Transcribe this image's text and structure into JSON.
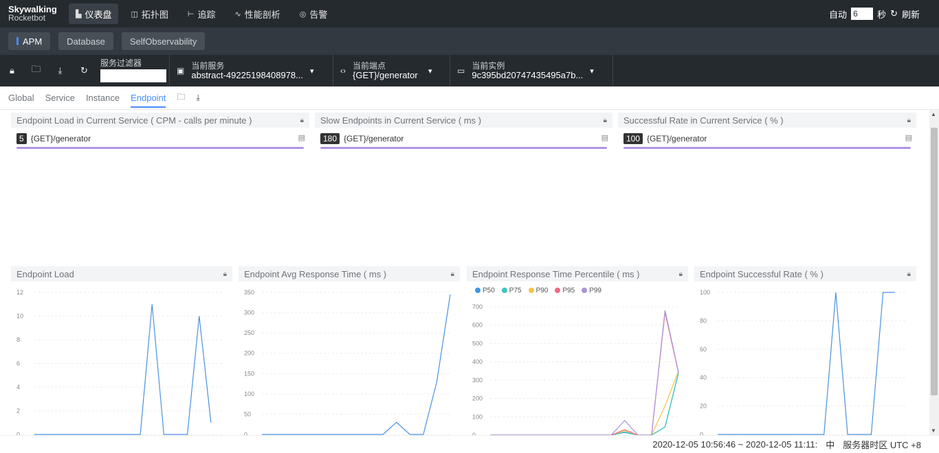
{
  "logo": {
    "line1": "Skywalking",
    "line2": "Rocketbot"
  },
  "nav": {
    "items": [
      {
        "label": "仪表盘",
        "icon": "dashboard-icon",
        "glyph": "▙",
        "active": true
      },
      {
        "label": "拓扑图",
        "icon": "topology-icon",
        "glyph": "◫",
        "active": false
      },
      {
        "label": "追踪",
        "icon": "trace-icon",
        "glyph": "⊢",
        "active": false
      },
      {
        "label": "性能剖析",
        "icon": "profile-icon",
        "glyph": "∿",
        "active": false
      },
      {
        "label": "告警",
        "icon": "alarm-icon",
        "glyph": "◎",
        "active": false
      }
    ],
    "auto_label": "自动",
    "auto_seconds": "6",
    "seconds_unit": "秒",
    "refresh_label": "刷新"
  },
  "groups": [
    "APM",
    "Database",
    "SelfObservability"
  ],
  "toolbar": {
    "filter_label": "服务过滤器",
    "filter_value": "",
    "service_label": "当前服务",
    "service_value": "abstract-49225198408978...",
    "endpoint_label": "当前端点",
    "endpoint_value": "{GET}/generator",
    "instance_label": "当前实例",
    "instance_value": "9c395bd20747435495a7b..."
  },
  "tabs": [
    "Global",
    "Service",
    "Instance",
    "Endpoint"
  ],
  "top_panels": [
    {
      "title": "Endpoint Load in Current Service ( CPM - calls per minute )",
      "value": "5",
      "endpoint": "{GET}/generator"
    },
    {
      "title": "Slow Endpoints in Current Service ( ms )",
      "value": "180",
      "endpoint": "{GET}/generator"
    },
    {
      "title": "Successful Rate in Current Service ( % )",
      "value": "100",
      "endpoint": "{GET}/generator"
    }
  ],
  "chart_titles": {
    "load": "Endpoint Load",
    "avg": "Endpoint Avg Response Time ( ms )",
    "percentile": "Endpoint Response Time Percentile ( ms )",
    "success": "Endpoint Successful Rate ( % )"
  },
  "colors": {
    "accent": "#448dfe",
    "line": "#4a90e2",
    "p50": "#3a98e6",
    "p75": "#3cc5c0",
    "p90": "#f8c24a",
    "p95": "#f06a84",
    "p99": "#a995d8"
  },
  "chart_data": [
    {
      "type": "line",
      "title": "Endpoint Load",
      "ylim": [
        0,
        12
      ],
      "yticks": [
        0,
        2,
        4,
        6,
        8,
        10,
        12
      ],
      "series": [
        {
          "values": [
            0,
            0,
            0,
            0,
            0,
            0,
            0,
            0,
            0,
            0,
            11,
            0,
            0,
            0,
            10,
            1
          ]
        }
      ]
    },
    {
      "type": "line",
      "title": "Endpoint Avg Response Time ( ms )",
      "ylim": [
        0,
        350
      ],
      "yticks": [
        0,
        50,
        100,
        150,
        200,
        250,
        300,
        350
      ],
      "series": [
        {
          "values": [
            0,
            0,
            0,
            0,
            0,
            0,
            0,
            0,
            0,
            0,
            30,
            0,
            0,
            130,
            345
          ]
        }
      ]
    },
    {
      "type": "line",
      "title": "Endpoint Response Time Percentile ( ms )",
      "ylim": [
        0,
        700
      ],
      "yticks": [
        0,
        100,
        200,
        300,
        400,
        500,
        600,
        700
      ],
      "series": [
        {
          "name": "P50",
          "values": [
            0,
            0,
            0,
            0,
            0,
            0,
            0,
            0,
            0,
            0,
            15,
            0,
            0,
            45,
            340
          ]
        },
        {
          "name": "P75",
          "values": [
            0,
            0,
            0,
            0,
            0,
            0,
            0,
            0,
            0,
            0,
            18,
            0,
            0,
            45,
            340
          ]
        },
        {
          "name": "P90",
          "values": [
            0,
            0,
            0,
            0,
            0,
            0,
            0,
            0,
            0,
            0,
            25,
            0,
            0,
            160,
            350
          ]
        },
        {
          "name": "P95",
          "values": [
            0,
            0,
            0,
            0,
            0,
            0,
            0,
            0,
            0,
            0,
            30,
            0,
            0,
            670,
            340
          ]
        },
        {
          "name": "P99",
          "values": [
            0,
            0,
            0,
            0,
            0,
            0,
            0,
            0,
            0,
            0,
            80,
            0,
            0,
            680,
            345
          ]
        }
      ]
    },
    {
      "type": "line",
      "title": "Endpoint Successful Rate ( % )",
      "ylim": [
        0,
        100
      ],
      "yticks": [
        0,
        20,
        40,
        60,
        80,
        100
      ],
      "series": [
        {
          "values": [
            0,
            0,
            0,
            0,
            0,
            0,
            0,
            0,
            0,
            0,
            100,
            0,
            0,
            0,
            100,
            100
          ]
        }
      ]
    }
  ],
  "footer": {
    "time_range": "2020-12-05 10:56:46 ~ 2020-12-05 11:11:",
    "lang": "中",
    "timezone": "服务器时区 UTC +8"
  }
}
